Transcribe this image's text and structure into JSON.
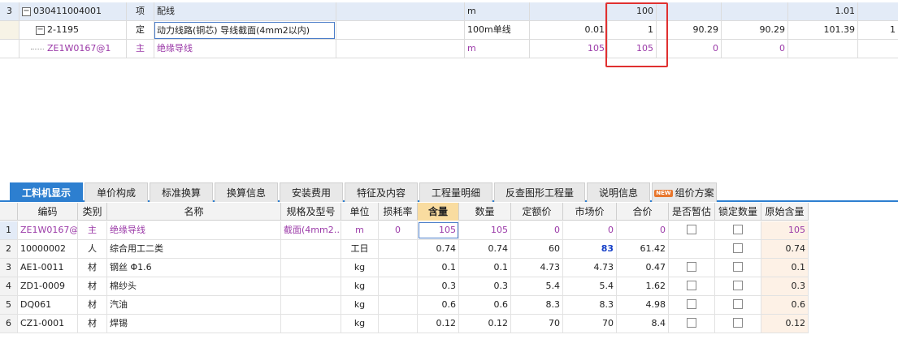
{
  "top_grid": {
    "rows": [
      {
        "index": "3",
        "code": "030411004001",
        "type": "项",
        "name": "配线",
        "unit": "m",
        "qty": "",
        "content": "100",
        "price1": "",
        "price2": "",
        "total": "1.01",
        "extra": ""
      },
      {
        "index": "",
        "code": "2-1195",
        "type": "定",
        "name": "动力线路(铜芯) 导线截面(4mm2以内)",
        "unit": "100m单线",
        "qty": "0.01",
        "content": "1",
        "price1": "90.29",
        "price2": "90.29",
        "total": "101.39",
        "extra": "1"
      },
      {
        "index": "",
        "code": "ZE1W0167@1",
        "type": "主",
        "name": "绝缘导线",
        "unit": "m",
        "qty": "105",
        "content": "105",
        "price1": "0",
        "price2": "0",
        "total": "",
        "extra": ""
      }
    ]
  },
  "tabs": [
    {
      "label": "工料机显示",
      "active": true
    },
    {
      "label": "单价构成"
    },
    {
      "label": "标准换算"
    },
    {
      "label": "换算信息"
    },
    {
      "label": "安装费用"
    },
    {
      "label": "特征及内容"
    },
    {
      "label": "工程量明细"
    },
    {
      "label": "反查图形工程量"
    },
    {
      "label": "说明信息"
    },
    {
      "label": "组价方案",
      "badge": "NEW"
    }
  ],
  "bottom_grid": {
    "headers": [
      "编码",
      "类别",
      "名称",
      "规格及型号",
      "单位",
      "损耗率",
      "含量",
      "数量",
      "定额价",
      "市场价",
      "合价",
      "是否暂估",
      "锁定数量",
      "原始含量"
    ],
    "rows": [
      {
        "n": "1",
        "code": "ZE1W0167@1",
        "cat": "主",
        "name": "绝缘导线",
        "spec": "截面(4mm2…",
        "unit": "m",
        "loss": "0",
        "content": "105",
        "qty": "105",
        "quota": "0",
        "market": "0",
        "total": "0",
        "orig": "105"
      },
      {
        "n": "2",
        "code": "10000002",
        "cat": "人",
        "name": "综合用工二类",
        "spec": "",
        "unit": "工日",
        "loss": "",
        "content": "0.74",
        "qty": "0.74",
        "quota": "60",
        "market": "83",
        "total": "61.42",
        "orig": "0.74"
      },
      {
        "n": "3",
        "code": "AE1-0011",
        "cat": "材",
        "name": "钢丝 Φ1.6",
        "spec": "",
        "unit": "kg",
        "loss": "",
        "content": "0.1",
        "qty": "0.1",
        "quota": "4.73",
        "market": "4.73",
        "total": "0.47",
        "orig": "0.1"
      },
      {
        "n": "4",
        "code": "ZD1-0009",
        "cat": "材",
        "name": "棉纱头",
        "spec": "",
        "unit": "kg",
        "loss": "",
        "content": "0.3",
        "qty": "0.3",
        "quota": "5.4",
        "market": "5.4",
        "total": "1.62",
        "orig": "0.3"
      },
      {
        "n": "5",
        "code": "DQ061",
        "cat": "材",
        "name": "汽油",
        "spec": "",
        "unit": "kg",
        "loss": "",
        "content": "0.6",
        "qty": "0.6",
        "quota": "8.3",
        "market": "8.3",
        "total": "4.98",
        "orig": "0.6"
      },
      {
        "n": "6",
        "code": "CZ1-0001",
        "cat": "材",
        "name": "焊锡",
        "spec": "",
        "unit": "kg",
        "loss": "",
        "content": "0.12",
        "qty": "0.12",
        "quota": "70",
        "market": "70",
        "total": "8.4",
        "orig": "0.12"
      }
    ]
  },
  "colors": {
    "accent": "#2d7fd0",
    "selected_row": "#e3ebf7",
    "main_material_text": "#9b3aa8",
    "highlight_border": "#e03030",
    "content_header": "#f9dca0",
    "market_price_changed": "#1640c8"
  }
}
